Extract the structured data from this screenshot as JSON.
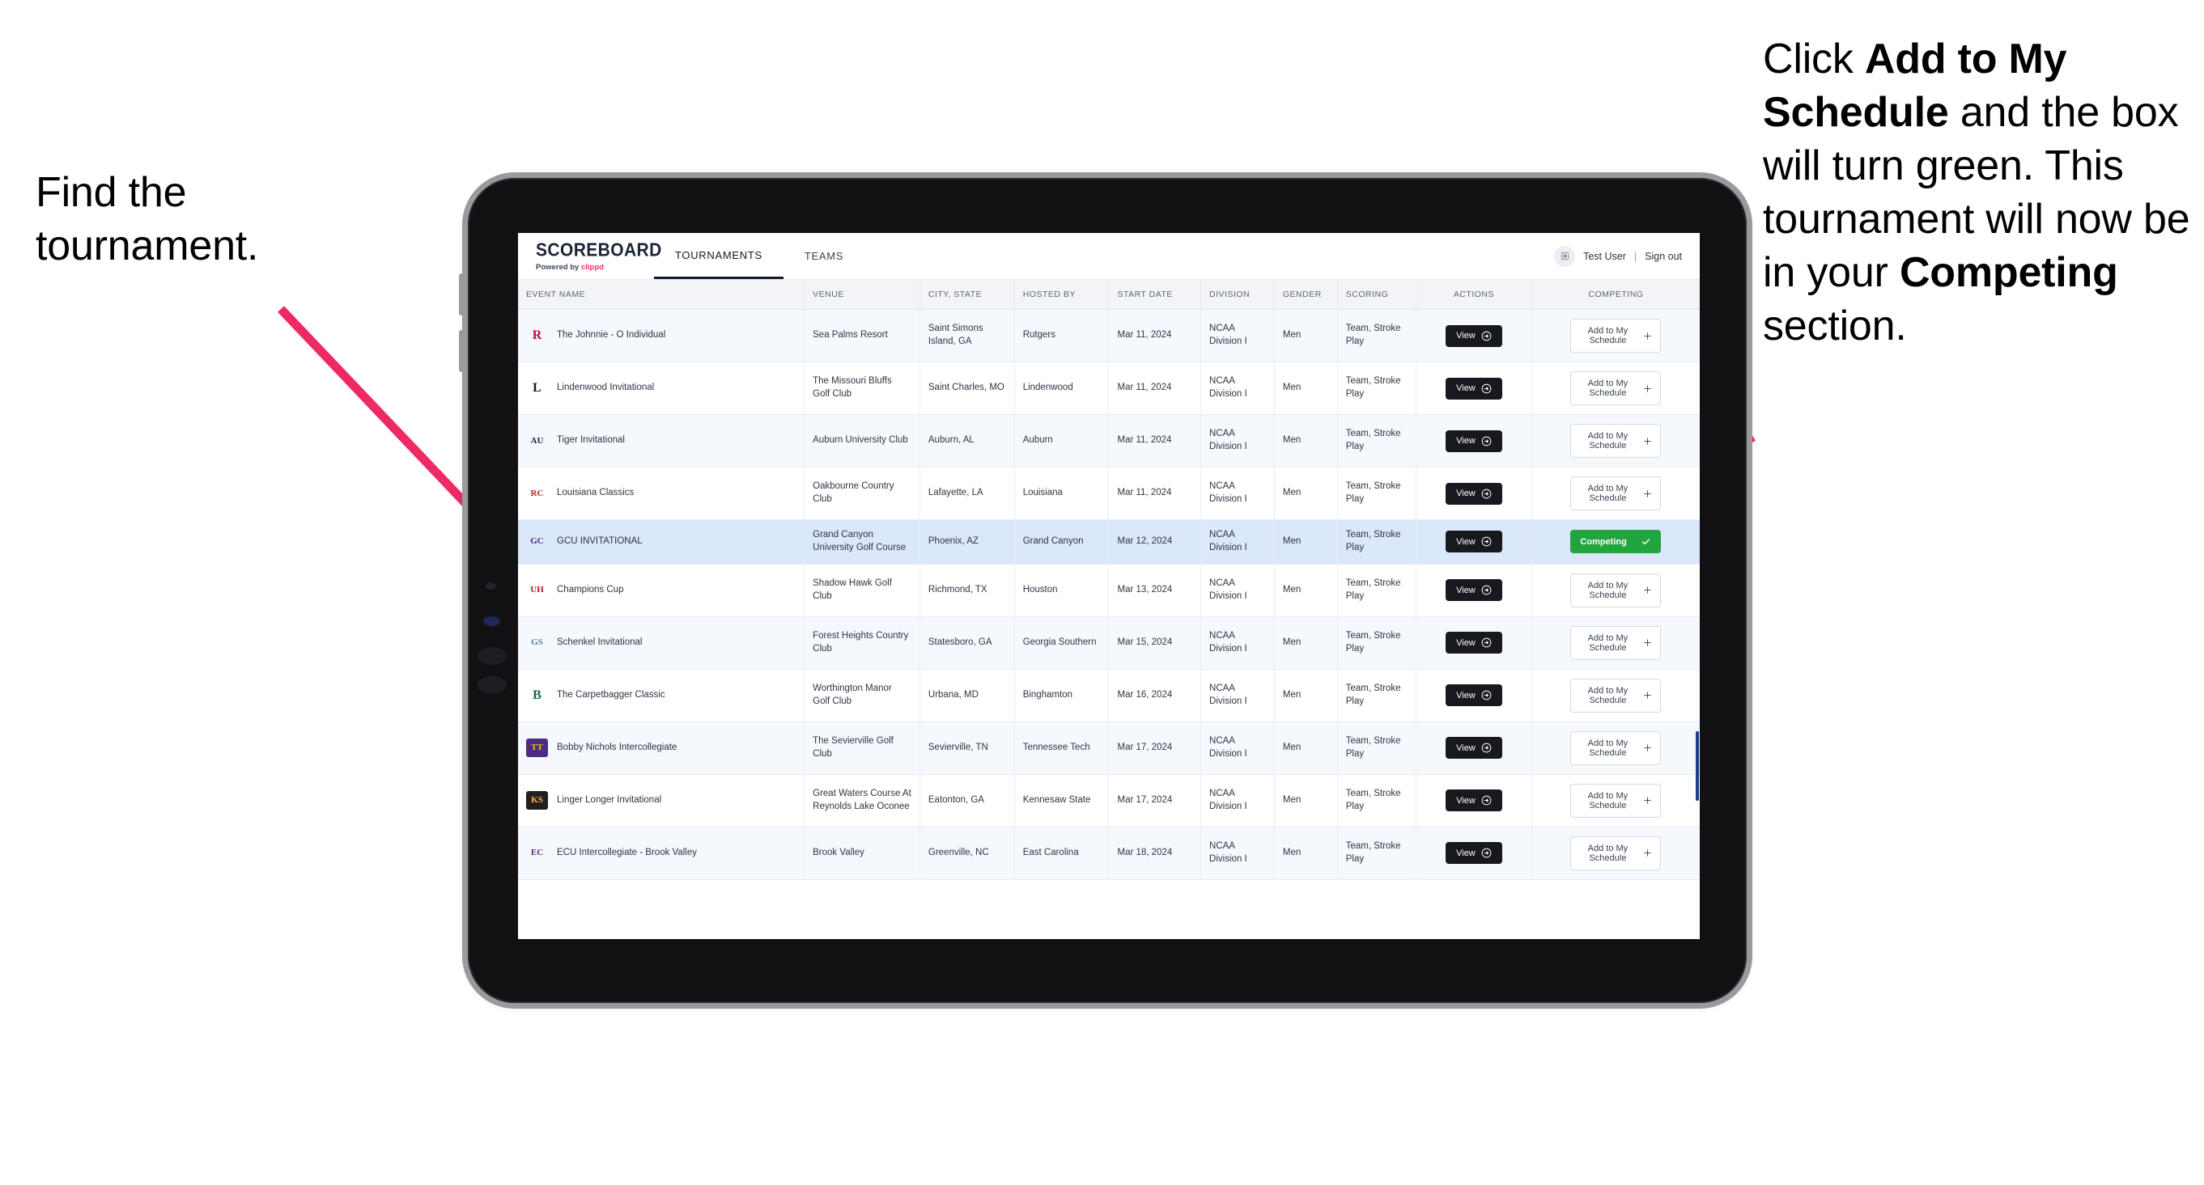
{
  "annotations": {
    "left": {
      "line1": "Find the",
      "line2": "tournament."
    },
    "right": {
      "seg1": "Click ",
      "bold1": "Add to My Schedule",
      "seg2": " and the box will turn green. This tournament will now be in your ",
      "bold2": "Competing",
      "seg3": " section."
    },
    "arrow_color": "#ED2B62"
  },
  "app": {
    "brand": {
      "title": "SCOREBOARD",
      "powered_prefix": "Powered by ",
      "powered_brand": "clippd"
    },
    "nav_tabs": [
      {
        "label": "TOURNAMENTS",
        "active": true
      },
      {
        "label": "TEAMS",
        "active": false
      }
    ],
    "header_right": {
      "avatar_icon": "user-avatar-icon",
      "user_name": "Test User",
      "separator": "|",
      "sign_out": "Sign out"
    }
  },
  "table": {
    "columns": [
      "EVENT NAME",
      "VENUE",
      "CITY, STATE",
      "HOSTED BY",
      "START DATE",
      "DIVISION",
      "GENDER",
      "SCORING",
      "ACTIONS",
      "COMPETING"
    ],
    "buttons": {
      "view_label": "View",
      "add_label": "Add to My Schedule",
      "competing_label": "Competing",
      "add_icon": "plus-icon",
      "view_icon": "circle-arrow-right-icon",
      "competing_icon": "check-icon"
    },
    "rows": [
      {
        "logo": {
          "text": "R",
          "color": "#CC0033",
          "bg": "transparent"
        },
        "event": "The Johnnie - O Individual",
        "venue": "Sea Palms Resort",
        "city": "Saint Simons Island, GA",
        "host": "Rutgers",
        "date": "Mar 11, 2024",
        "division": "NCAA Division I",
        "gender": "Men",
        "scoring": "Team, Stroke Play",
        "competing": false,
        "selected": false
      },
      {
        "logo": {
          "text": "L",
          "color": "#1c1c1c",
          "bg": "transparent"
        },
        "event": "Lindenwood Invitational",
        "venue": "The Missouri Bluffs Golf Club",
        "city": "Saint Charles, MO",
        "host": "Lindenwood",
        "date": "Mar 11, 2024",
        "division": "NCAA Division I",
        "gender": "Men",
        "scoring": "Team, Stroke Play",
        "competing": false,
        "selected": false
      },
      {
        "logo": {
          "text": "AU",
          "color": "#0C2340",
          "bg": "transparent"
        },
        "event": "Tiger Invitational",
        "venue": "Auburn University Club",
        "city": "Auburn, AL",
        "host": "Auburn",
        "date": "Mar 11, 2024",
        "division": "NCAA Division I",
        "gender": "Men",
        "scoring": "Team, Stroke Play",
        "competing": false,
        "selected": false
      },
      {
        "logo": {
          "text": "RC",
          "color": "#CE181E",
          "bg": "#ffffff"
        },
        "event": "Louisiana Classics",
        "venue": "Oakbourne Country Club",
        "city": "Lafayette, LA",
        "host": "Louisiana",
        "date": "Mar 11, 2024",
        "division": "NCAA Division I",
        "gender": "Men",
        "scoring": "Team, Stroke Play",
        "competing": false,
        "selected": false
      },
      {
        "logo": {
          "text": "GC",
          "color": "#522398",
          "bg": "transparent"
        },
        "event": "GCU INVITATIONAL",
        "venue": "Grand Canyon University Golf Course",
        "city": "Phoenix, AZ",
        "host": "Grand Canyon",
        "date": "Mar 12, 2024",
        "division": "NCAA Division I",
        "gender": "Men",
        "scoring": "Team, Stroke Play",
        "competing": true,
        "selected": true
      },
      {
        "logo": {
          "text": "UH",
          "color": "#C8102E",
          "bg": "transparent"
        },
        "event": "Champions Cup",
        "venue": "Shadow Hawk Golf Club",
        "city": "Richmond, TX",
        "host": "Houston",
        "date": "Mar 13, 2024",
        "division": "NCAA Division I",
        "gender": "Men",
        "scoring": "Team, Stroke Play",
        "competing": false,
        "selected": false
      },
      {
        "logo": {
          "text": "GS",
          "color": "#5A7C9B",
          "bg": "transparent"
        },
        "event": "Schenkel Invitational",
        "venue": "Forest Heights Country Club",
        "city": "Statesboro, GA",
        "host": "Georgia Southern",
        "date": "Mar 15, 2024",
        "division": "NCAA Division I",
        "gender": "Men",
        "scoring": "Team, Stroke Play",
        "competing": false,
        "selected": false
      },
      {
        "logo": {
          "text": "B",
          "color": "#0E6B4F",
          "bg": "transparent"
        },
        "event": "The Carpetbagger Classic",
        "venue": "Worthington Manor Golf Club",
        "city": "Urbana, MD",
        "host": "Binghamton",
        "date": "Mar 16, 2024",
        "division": "NCAA Division I",
        "gender": "Men",
        "scoring": "Team, Stroke Play",
        "competing": false,
        "selected": false
      },
      {
        "logo": {
          "text": "TT",
          "color": "#F1C400",
          "bg": "#4B2E83"
        },
        "event": "Bobby Nichols Intercollegiate",
        "venue": "The Sevierville Golf Club",
        "city": "Sevierville, TN",
        "host": "Tennessee Tech",
        "date": "Mar 17, 2024",
        "division": "NCAA Division I",
        "gender": "Men",
        "scoring": "Team, Stroke Play",
        "competing": false,
        "selected": false
      },
      {
        "logo": {
          "text": "KS",
          "color": "#FDBB30",
          "bg": "#231F20"
        },
        "event": "Linger Longer Invitational",
        "venue": "Great Waters Course At Reynolds Lake Oconee",
        "city": "Eatonton, GA",
        "host": "Kennesaw State",
        "date": "Mar 17, 2024",
        "division": "NCAA Division I",
        "gender": "Men",
        "scoring": "Team, Stroke Play",
        "competing": false,
        "selected": false
      },
      {
        "logo": {
          "text": "EC",
          "color": "#592A8A",
          "bg": "transparent"
        },
        "event": "ECU Intercollegiate - Brook Valley",
        "venue": "Brook Valley",
        "city": "Greenville, NC",
        "host": "East Carolina",
        "date": "Mar 18, 2024",
        "division": "NCAA Division I",
        "gender": "Men",
        "scoring": "Team, Stroke Play",
        "competing": false,
        "selected": false
      }
    ]
  }
}
